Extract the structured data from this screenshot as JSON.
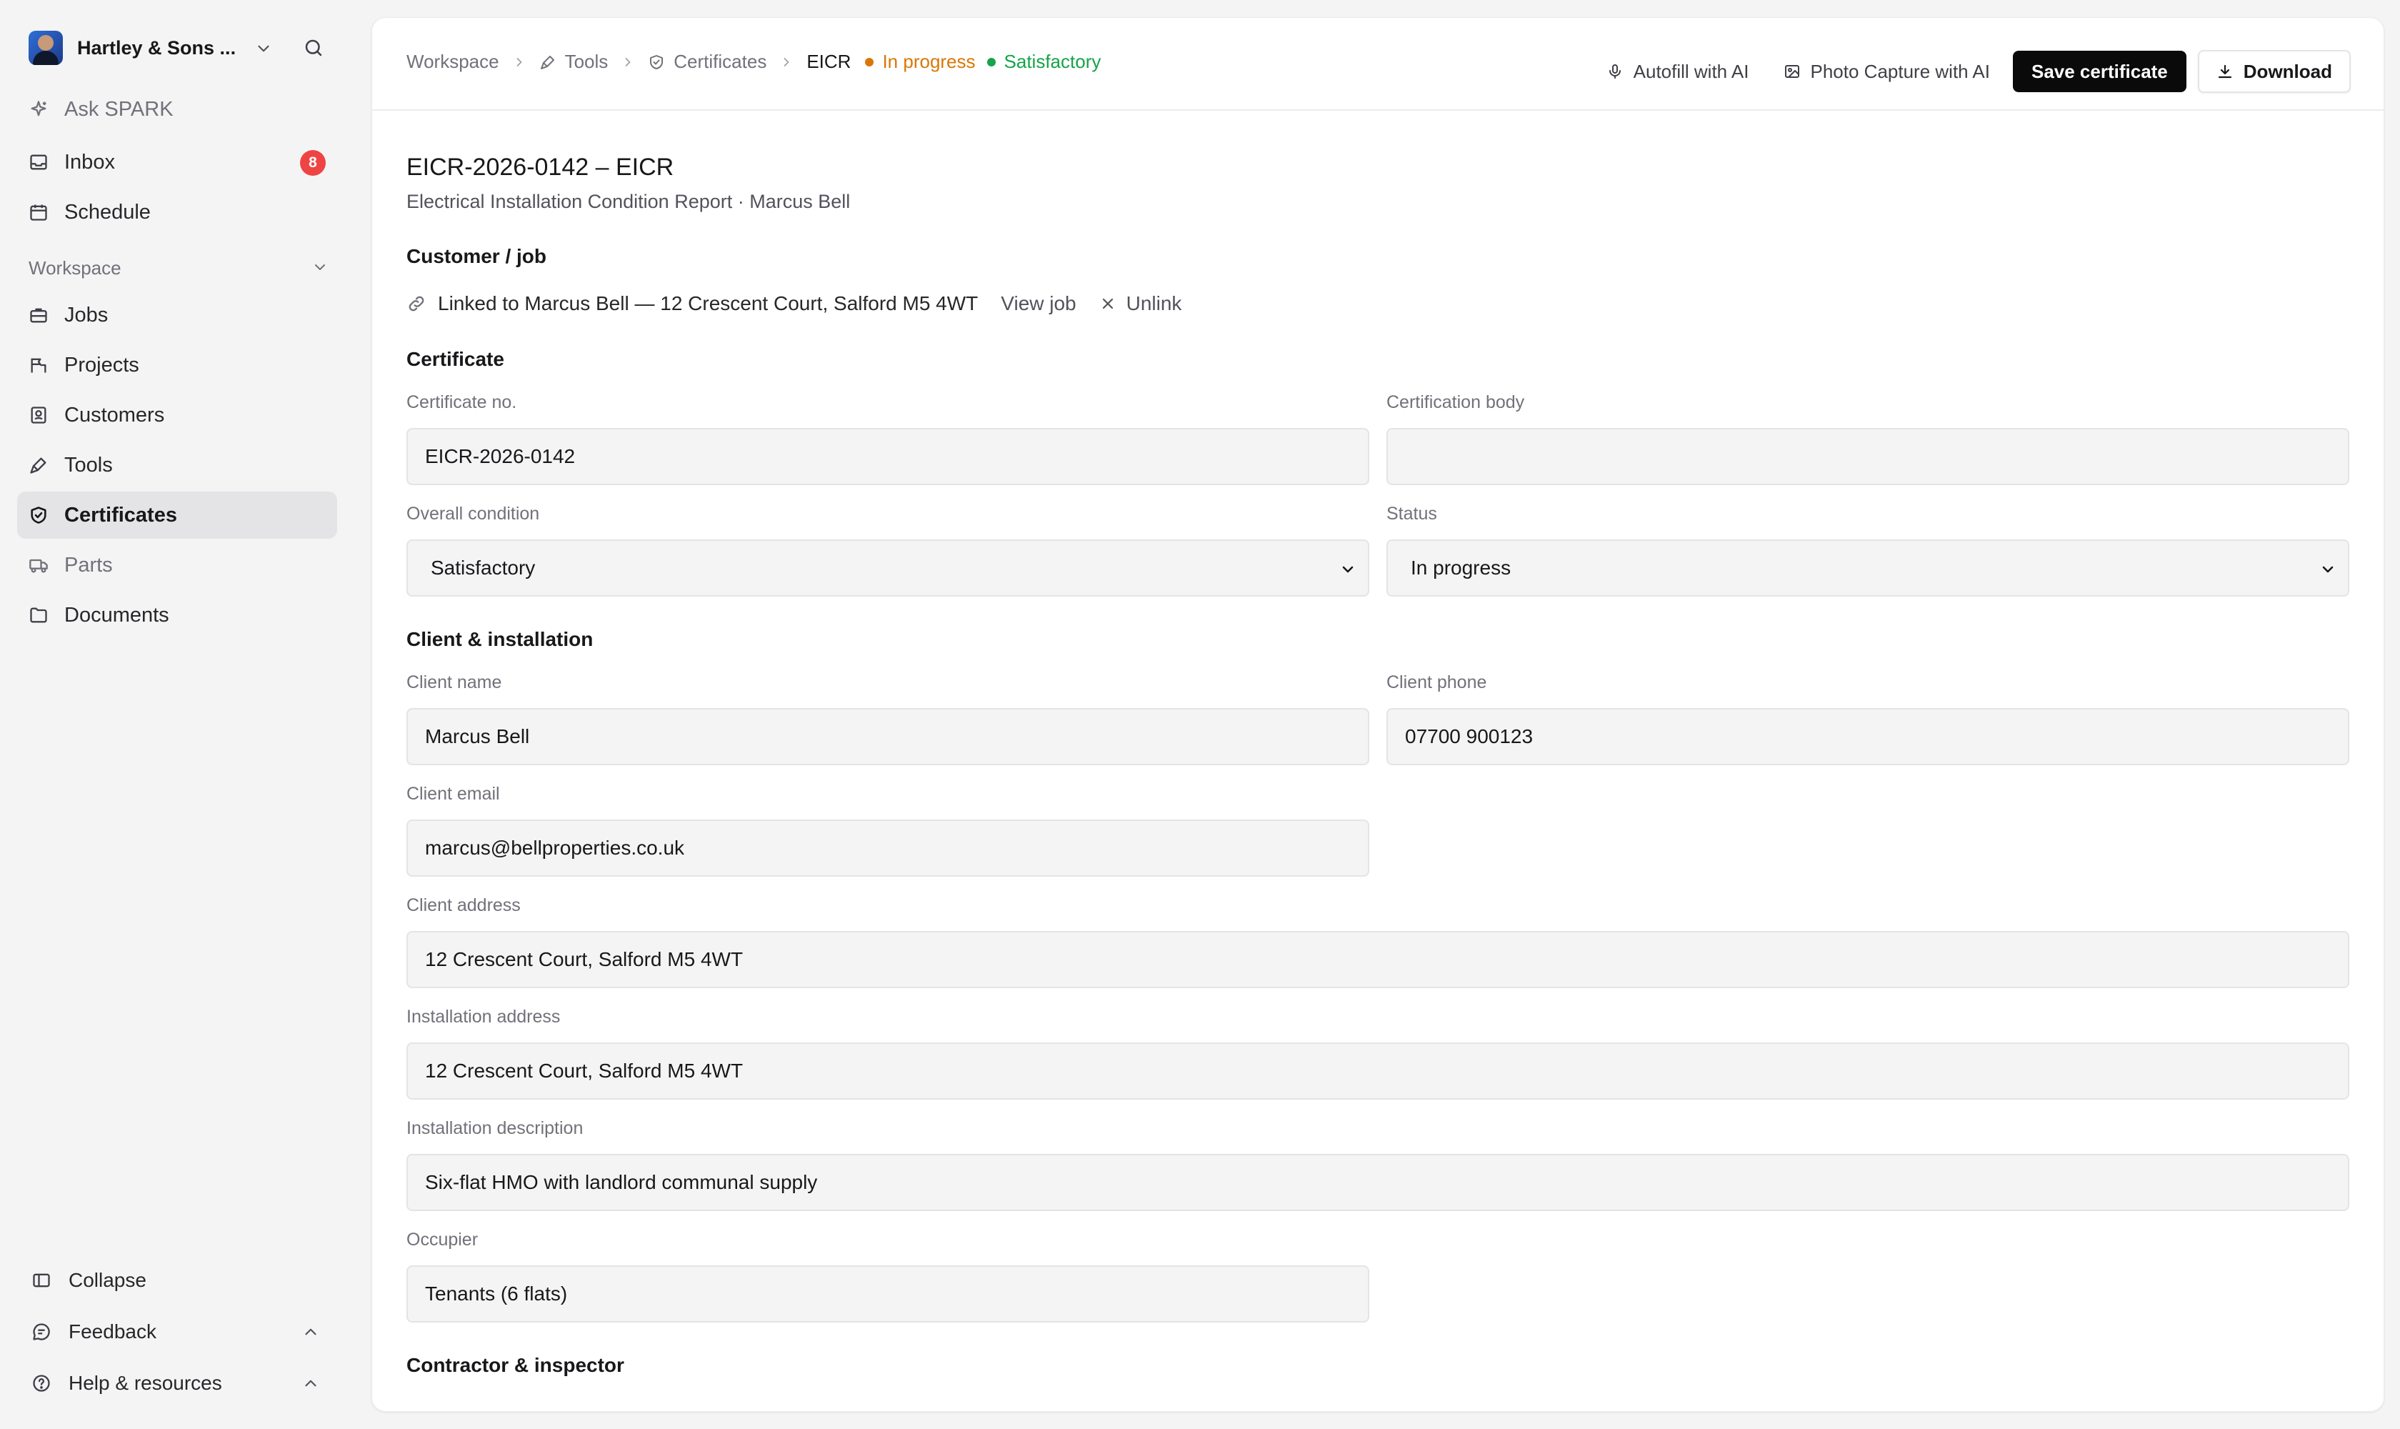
{
  "sidebar": {
    "org_name": "Hartley & Sons ...",
    "top_items": [
      {
        "label": "Ask SPARK"
      },
      {
        "label": "Inbox",
        "badge": "8"
      },
      {
        "label": "Schedule"
      }
    ],
    "workspace_heading": "Workspace",
    "workspace_items": [
      {
        "label": "Jobs"
      },
      {
        "label": "Projects"
      },
      {
        "label": "Customers"
      },
      {
        "label": "Tools"
      },
      {
        "label": "Certificates",
        "active": true
      },
      {
        "label": "Parts"
      },
      {
        "label": "Documents"
      }
    ],
    "bottom_items": [
      {
        "label": "Collapse"
      },
      {
        "label": "Feedback"
      },
      {
        "label": "Help & resources"
      }
    ]
  },
  "breadcrumb": {
    "items": [
      "Workspace",
      "Tools",
      "Certificates",
      "EICR"
    ],
    "status_in_progress": "In progress",
    "status_satisfactory": "Satisfactory"
  },
  "actions": {
    "autofill": "Autofill with AI",
    "photo_capture": "Photo Capture with AI",
    "save": "Save certificate",
    "download": "Download"
  },
  "header": {
    "title": "EICR-2026-0142 – EICR",
    "subtitle": "Electrical Installation Condition Report · Marcus Bell"
  },
  "customer_job": {
    "heading": "Customer / job",
    "linked_text": "Linked to Marcus Bell — 12 Crescent Court, Salford M5 4WT",
    "view_job": "View job",
    "unlink": "Unlink"
  },
  "certificate": {
    "heading": "Certificate",
    "cert_no_label": "Certificate no.",
    "cert_no_value": "EICR-2026-0142",
    "cert_body_label": "Certification body",
    "cert_body_value": "",
    "overall_condition_label": "Overall condition",
    "overall_condition_value": "Satisfactory",
    "status_label": "Status",
    "status_value": "In progress"
  },
  "client_installation": {
    "heading": "Client & installation",
    "client_name_label": "Client name",
    "client_name_value": "Marcus Bell",
    "client_phone_label": "Client phone",
    "client_phone_value": "07700 900123",
    "client_email_label": "Client email",
    "client_email_value": "marcus@bellproperties.co.uk",
    "client_address_label": "Client address",
    "client_address_value": "12 Crescent Court, Salford M5 4WT",
    "installation_address_label": "Installation address",
    "installation_address_value": "12 Crescent Court, Salford M5 4WT",
    "installation_description_label": "Installation description",
    "installation_description_value": "Six-flat HMO with landlord communal supply",
    "occupier_label": "Occupier",
    "occupier_value": "Tenants (6 flats)"
  },
  "contractor": {
    "heading": "Contractor & inspector"
  },
  "colors": {
    "in_progress": "#d97706",
    "satisfactory": "#16a34a",
    "badge": "#ef4444",
    "primary_button": "#0a0a0a"
  }
}
